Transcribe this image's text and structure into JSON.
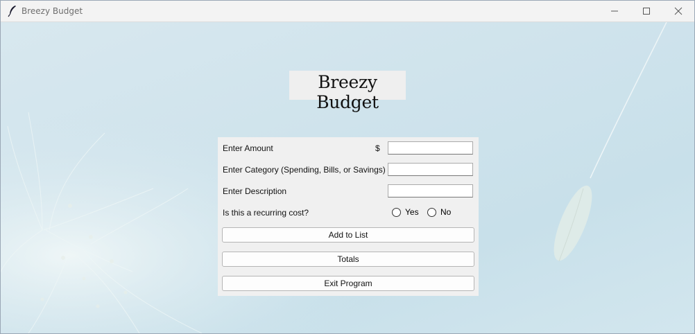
{
  "window": {
    "title": "Breezy Budget",
    "app_icon": "feather-icon",
    "controls": [
      "minimize-icon",
      "maximize-icon",
      "close-icon"
    ]
  },
  "heading": "Breezy Budget",
  "form": {
    "amount_label": "Enter Amount",
    "currency_symbol": "$",
    "amount_value": "",
    "category_label": "Enter Category (Spending, Bills, or Savings)",
    "category_value": "",
    "description_label": "Enter Description",
    "description_value": "",
    "recurring_label": "Is this a recurring cost?",
    "recurring_options": [
      "Yes",
      "No"
    ],
    "recurring_selected": null
  },
  "buttons": {
    "add": "Add to List",
    "totals": "Totals",
    "exit": "Exit Program"
  },
  "colors": {
    "background": "#cfe3ec",
    "panel": "#f0f0f0",
    "titlebar": "#f3f3f3"
  }
}
